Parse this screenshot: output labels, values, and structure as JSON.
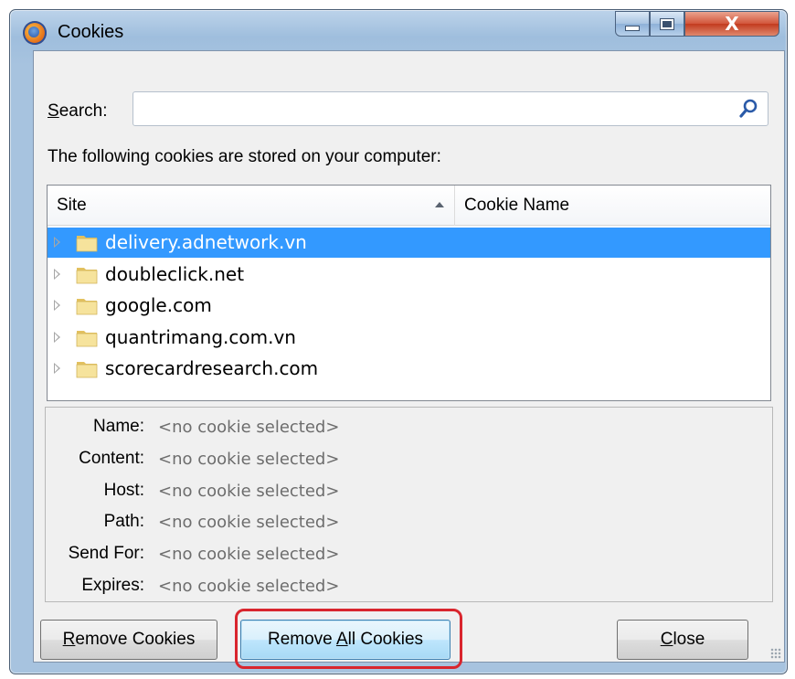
{
  "window": {
    "title": "Cookies"
  },
  "titlebar": {
    "close_glyph": "X"
  },
  "search": {
    "label_prefix": "S",
    "label_rest": "earch:",
    "value": "",
    "placeholder": ""
  },
  "stored_text": "The following cookies are stored on your computer:",
  "tree": {
    "columns": {
      "site": "Site",
      "cookie_name": "Cookie Name"
    },
    "rows": [
      {
        "site": "delivery.adnetwork.vn",
        "selected": true
      },
      {
        "site": "doubleclick.net",
        "selected": false
      },
      {
        "site": "google.com",
        "selected": false
      },
      {
        "site": "quantrimang.com.vn",
        "selected": false
      },
      {
        "site": "scorecardresearch.com",
        "selected": false
      }
    ]
  },
  "details": {
    "fields": [
      {
        "label": "Name:",
        "value": "<no cookie selected>"
      },
      {
        "label": "Content:",
        "value": "<no cookie selected>"
      },
      {
        "label": "Host:",
        "value": "<no cookie selected>"
      },
      {
        "label": "Path:",
        "value": "<no cookie selected>"
      },
      {
        "label": "Send For:",
        "value": "<no cookie selected>"
      },
      {
        "label": "Expires:",
        "value": "<no cookie selected>"
      }
    ]
  },
  "buttons": {
    "remove_cookies": {
      "prefix": "R",
      "rest": "emove Cookies"
    },
    "remove_all": {
      "before": "Remove ",
      "mnemonic": "A",
      "after": "ll Cookies"
    },
    "close": {
      "prefix": "C",
      "rest": "lose"
    }
  },
  "colors": {
    "selection": "#3399ff",
    "highlight_ring": "#d9252d"
  }
}
